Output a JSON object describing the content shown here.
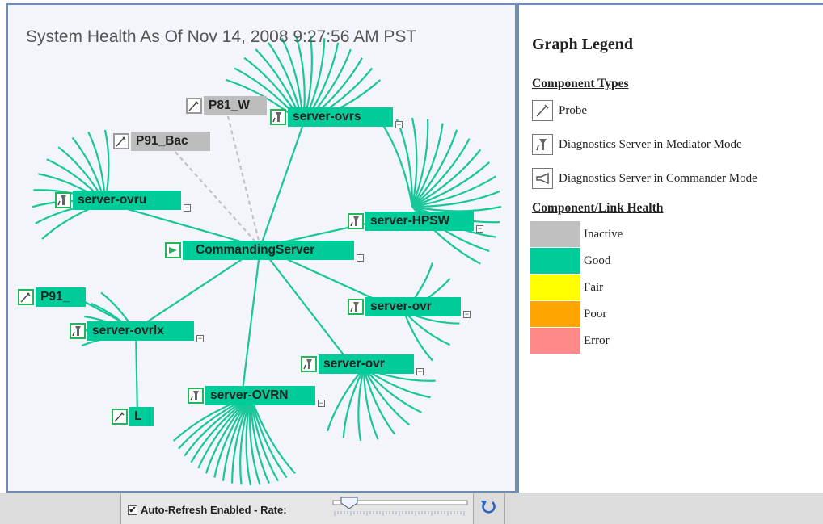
{
  "graph": {
    "title": "System Health As Of Nov 14, 2008 9:27:56 AM PST",
    "nodes": {
      "p81_w": {
        "label": "P81_W",
        "type": "probe",
        "health": "inactive"
      },
      "server_ovrs": {
        "label": "server-ovrs",
        "type": "mediator",
        "health": "good"
      },
      "p91_bac": {
        "label": "P91_Bac",
        "type": "probe",
        "health": "inactive"
      },
      "server_ovru": {
        "label": "server-ovru",
        "type": "mediator",
        "health": "good"
      },
      "server_hpsw": {
        "label": "server-HPSW",
        "type": "mediator",
        "health": "good"
      },
      "commanding_server": {
        "label": "CommandingServer",
        "type": "commander",
        "health": "good"
      },
      "p91": {
        "label": "P91_",
        "type": "probe",
        "health": "good"
      },
      "server_ovrlx": {
        "label": "server-ovrlx",
        "type": "mediator",
        "health": "good"
      },
      "server_ovr_1": {
        "label": "server-ovr",
        "type": "mediator",
        "health": "good"
      },
      "server_ovr_2": {
        "label": "server-ovr",
        "type": "mediator",
        "health": "good"
      },
      "server_ovrn": {
        "label": "server-OVRN",
        "type": "mediator",
        "health": "good"
      },
      "l": {
        "label": "L",
        "type": "probe",
        "health": "good"
      }
    }
  },
  "legend": {
    "title": "Graph Legend",
    "types_heading": "Component Types",
    "types": [
      {
        "label": "Probe",
        "icon": "probe-icon"
      },
      {
        "label": "Diagnostics Server in Mediator Mode",
        "icon": "mediator-server-icon"
      },
      {
        "label": "Diagnostics Server in Commander Mode",
        "icon": "commander-server-icon"
      }
    ],
    "health_heading": "Component/Link Health",
    "health": [
      {
        "label": "Inactive",
        "color": "#c0c0c0"
      },
      {
        "label": "Good",
        "color": "#00cc99"
      },
      {
        "label": "Fair",
        "color": "#ffff00"
      },
      {
        "label": "Poor",
        "color": "#ffa500"
      },
      {
        "label": "Error",
        "color": "#ff8888"
      }
    ]
  },
  "status_bar": {
    "auto_refresh_label": "Auto-Refresh Enabled - Rate:",
    "auto_refresh_checked": true,
    "refresh_rate_fraction": 0.12,
    "refresh_icon": "refresh-icon"
  }
}
